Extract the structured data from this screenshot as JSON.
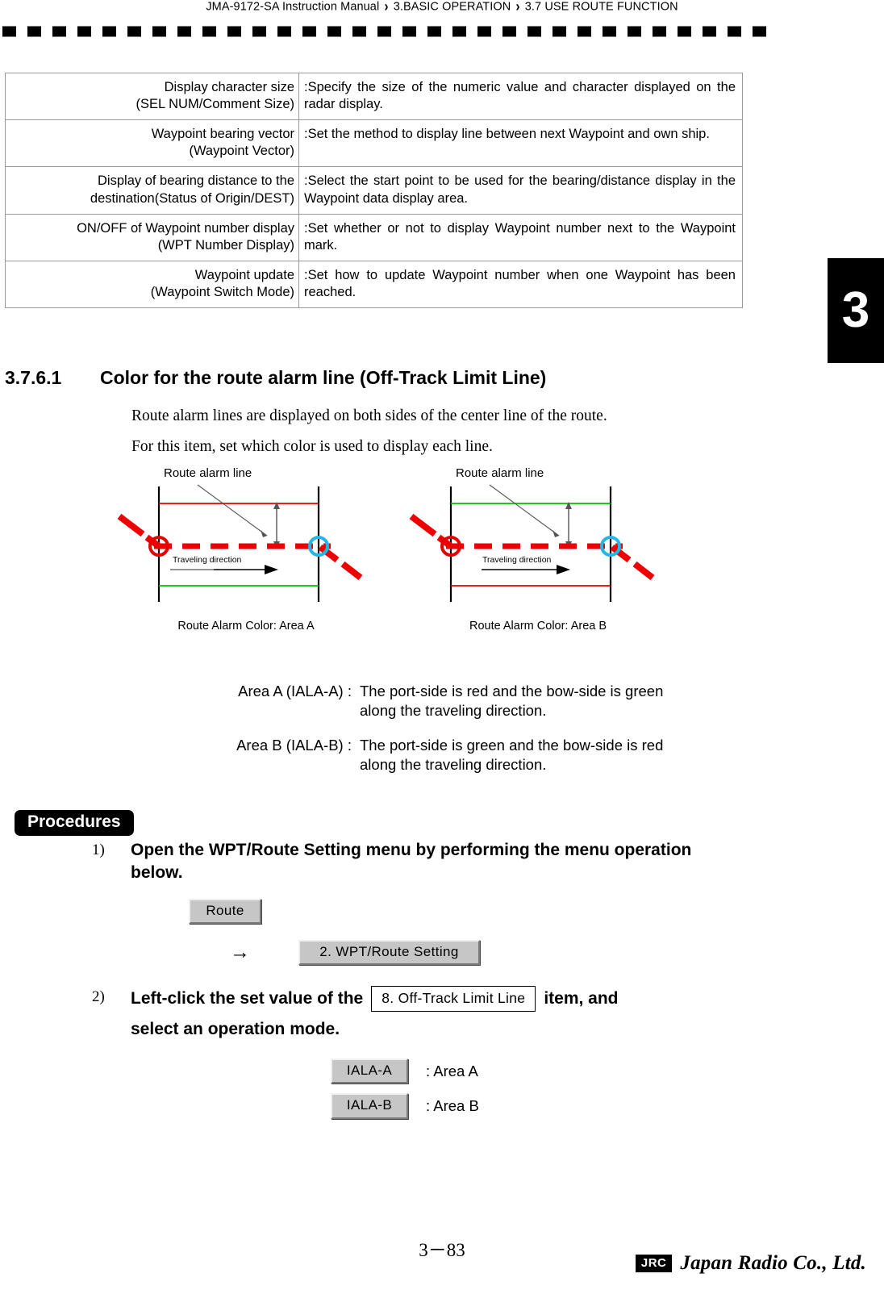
{
  "header": {
    "manual": "JMA-9172-SA Instruction Manual",
    "separator": "›",
    "chapter": "3.BASIC OPERATION",
    "section": "3.7  USE ROUTE FUNCTION"
  },
  "chapter_tab": {
    "number": "3"
  },
  "settings_table": {
    "rows": [
      {
        "term_lines": [
          "Display character size",
          "(SEL NUM/Comment Size)"
        ],
        "description": ":Specify the size of the numeric value and character displayed on the radar display."
      },
      {
        "term_lines": [
          "Waypoint bearing vector",
          "(Waypoint Vector)"
        ],
        "description": ":Set the method to display line between next Waypoint and own ship."
      },
      {
        "term_lines": [
          "Display of bearing distance to the",
          "destination(Status of Origin/DEST)"
        ],
        "description": ":Select the start point to be used for the bearing/distance display in the Waypoint data display area."
      },
      {
        "term_lines": [
          "ON/OFF of Waypoint number display",
          "(WPT Number Display)"
        ],
        "description": ":Set whether or not to display Waypoint number next to the Waypoint mark."
      },
      {
        "term_lines": [
          "Waypoint update",
          "(Waypoint Switch Mode)"
        ],
        "description": ":Set how to update Waypoint number when one Waypoint has been reached."
      }
    ]
  },
  "section": {
    "number": "3.7.6.1",
    "title": "Color for the route alarm line (Off-Track Limit Line)",
    "paragraph1": "Route alarm lines are displayed on both sides of the center line of the route.",
    "paragraph2": "For this item, set which color is used to display each line."
  },
  "figures": [
    {
      "id": "area-a",
      "annotation_label": "Route alarm line",
      "direction_label": "Traveling direction",
      "caption": "Route Alarm Color: Area A",
      "top_line_color": "#e50000",
      "bottom_line_color": "#00c000",
      "center_line_color": "#ee0000",
      "boundary_color": "#000000",
      "start_marker_color": "#e50000",
      "end_marker_color": "#22b7e8"
    },
    {
      "id": "area-b",
      "annotation_label": "Route alarm line",
      "direction_label": "Traveling direction",
      "caption": "Route Alarm Color: Area B",
      "top_line_color": "#00c000",
      "bottom_line_color": "#e50000",
      "center_line_color": "#ee0000",
      "boundary_color": "#000000",
      "start_marker_color": "#e50000",
      "end_marker_color": "#22b7e8"
    }
  ],
  "definitions": [
    {
      "label": "Area A (IALA-A) :",
      "line1": "The port-side is red and the bow-side is green",
      "line2": "along the traveling direction."
    },
    {
      "label": "Area B (IALA-B) :",
      "line1": "The port-side is green and the bow-side is red",
      "line2": "along the traveling direction."
    }
  ],
  "procedures": {
    "badge": "Procedures",
    "step1": {
      "number": "1)",
      "text": "Open the WPT/Route Setting menu by performing the menu operation below.",
      "button_route": "Route",
      "arrow": "→",
      "button_wpt_route_setting": "2. WPT/Route Setting"
    },
    "step2": {
      "number": "2)",
      "text_before": "Left-click the set value of the",
      "field": "8. Off-Track Limit Line",
      "text_after": "item, and",
      "text_line2": "select an operation mode.",
      "modes": [
        {
          "button": "IALA-A",
          "description": ": Area A"
        },
        {
          "button": "IALA-B",
          "description": ": Area B"
        }
      ]
    }
  },
  "footer": {
    "page": "3－83",
    "logo_mark": "JRC",
    "logo_word": "Japan Radio Co., Ltd."
  }
}
